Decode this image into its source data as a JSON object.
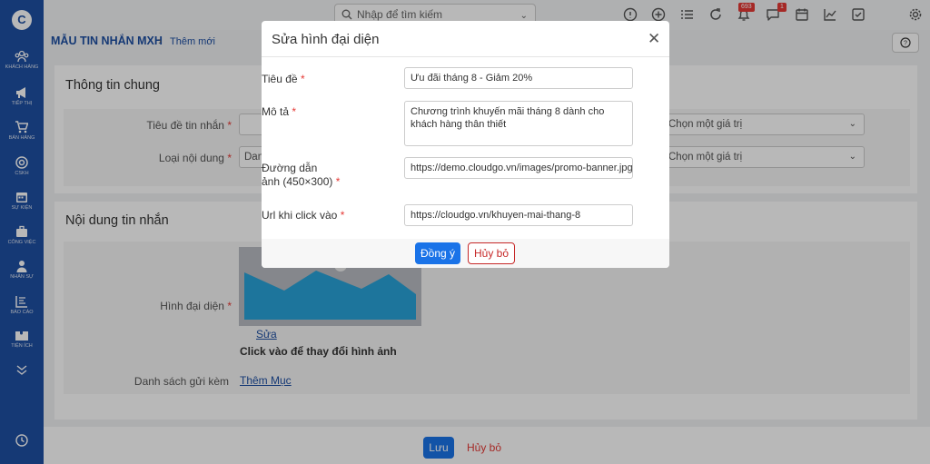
{
  "app": {
    "logo": "C"
  },
  "sidebar": {
    "items": [
      {
        "label": "Khách hàng",
        "icon": "users-icon"
      },
      {
        "label": "Tiếp thị",
        "icon": "megaphone-icon"
      },
      {
        "label": "Bán hàng",
        "icon": "cart-icon"
      },
      {
        "label": "CSKH",
        "icon": "support-icon"
      },
      {
        "label": "Sự kiện",
        "icon": "calendar-icon"
      },
      {
        "label": "Công việc",
        "icon": "briefcase-icon"
      },
      {
        "label": "Nhân sự",
        "icon": "person-icon"
      },
      {
        "label": "Báo cáo",
        "icon": "report-icon"
      },
      {
        "label": "Tiện ích",
        "icon": "puzzle-icon"
      }
    ]
  },
  "topbar": {
    "search_placeholder": "Nhập để tìm kiếm",
    "notifications_badge": "693",
    "messages_badge": "1"
  },
  "breadcrumb": {
    "module": "MẪU TIN NHẮN MXH",
    "current": "Thêm mới"
  },
  "form": {
    "general_title": "Thông tin chung",
    "title_label": "Tiêu đề tin nhắn",
    "type_label": "Loại nội dung",
    "type_value": "Dan",
    "select_placeholder_1": "Chọn một giá trị",
    "select_placeholder_2": "Chọn một giá trị",
    "content_title": "Nội dung tin nhắn",
    "image_label": "Hình đại diện",
    "edit_link": "Sửa",
    "click_hint": "Click vào để thay đổi hình ảnh",
    "attachments_label": "Danh sách gửi kèm",
    "add_item_link": "Thêm Mục"
  },
  "footer": {
    "save": "Lưu",
    "cancel": "Hủy bỏ"
  },
  "modal": {
    "title": "Sửa hình đại diện",
    "fields": {
      "title_label": "Tiêu đề",
      "title_value": "Ưu đãi tháng 8 - Giảm 20%",
      "desc_label": "Mô tả",
      "desc_value": "Chương trình khuyến mãi tháng 8 dành cho khách hàng thân thiết",
      "image_url_label_1": "Đường dẫn",
      "image_url_label_2": "ảnh (450×300)",
      "image_url_value": "https://demo.cloudgo.vn/images/promo-banner.jpg",
      "click_url_label": "Url khi click vào",
      "click_url_value": "https://cloudgo.vn/khuyen-mai-thang-8"
    },
    "ok_label": "Đồng ý",
    "cancel_label": "Hủy bỏ",
    "required_mark": "*"
  },
  "colors": {
    "primary": "#1a73e8",
    "sidebar": "#1e4fa3",
    "danger": "#e53935"
  }
}
